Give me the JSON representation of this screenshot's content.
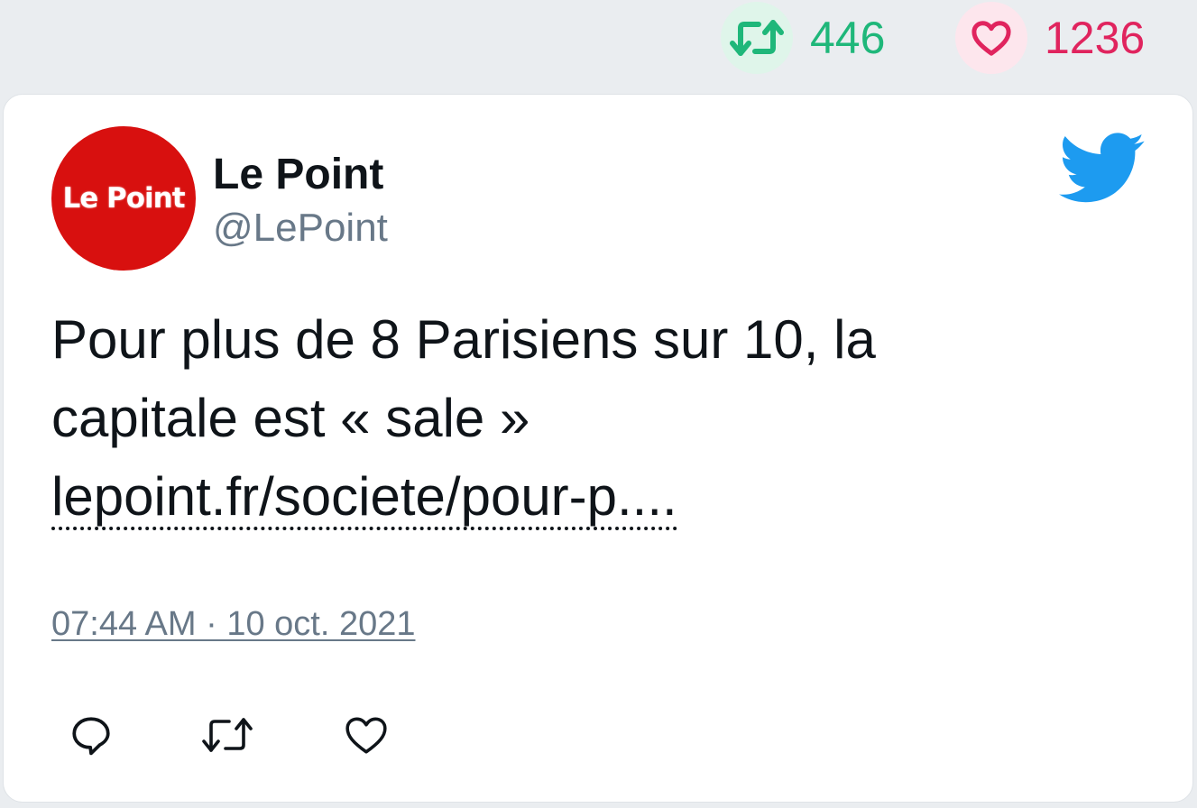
{
  "stats": {
    "retweet_icon": "retweet-icon",
    "retweet_count": "446",
    "like_icon": "heart-icon",
    "like_count": "1236",
    "retweet_color": "#1fb77a",
    "like_color": "#e0245e"
  },
  "tweet": {
    "author": {
      "display_name": "Le Point",
      "handle": "@LePoint",
      "avatar_text": "Le Point",
      "avatar_color": "#d8100f"
    },
    "brand_icon": "twitter-bird-icon",
    "brand_color": "#1d9bf0",
    "text_lines": [
      "Pour plus de 8 Parisiens sur 10, la",
      "capitale est « sale »"
    ],
    "link": "lepoint.fr/societe/pour-p....",
    "timestamp": "07:44 AM · 10 oct. 2021",
    "actions": [
      {
        "icon": "reply-icon"
      },
      {
        "icon": "retweet-icon"
      },
      {
        "icon": "heart-icon"
      }
    ]
  }
}
